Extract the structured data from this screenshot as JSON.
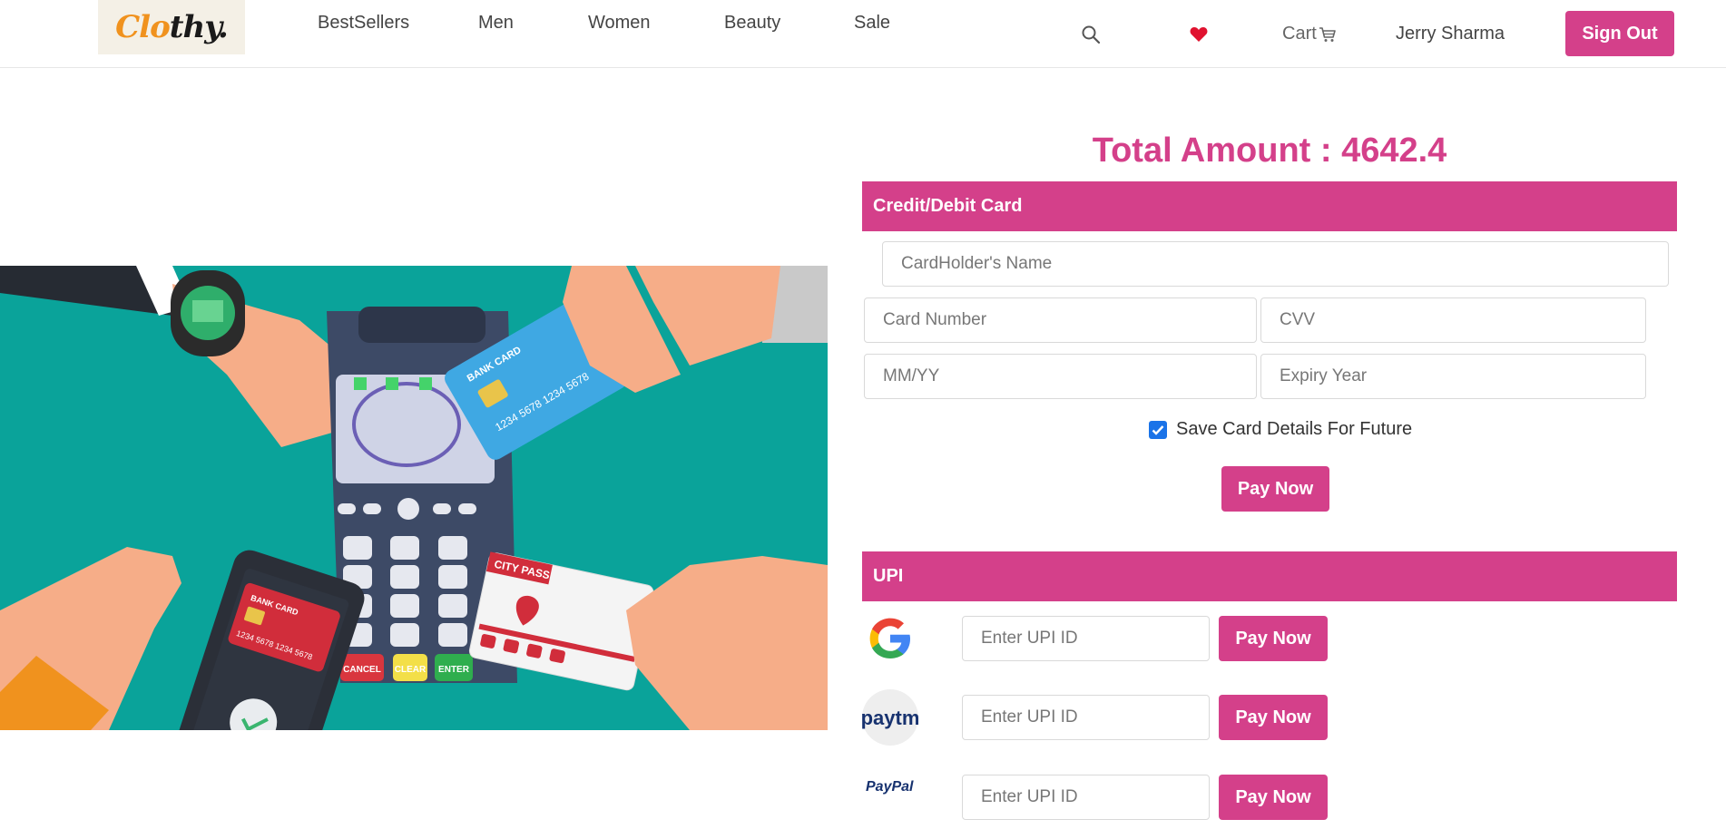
{
  "navbar": {
    "logo": {
      "orange": "Clo",
      "dark": "thy."
    },
    "links": [
      "BestSellers",
      "Men",
      "Women",
      "Beauty",
      "Sale"
    ],
    "search_icon": "search-icon",
    "wishlist_icon": "heart-icon",
    "cart_label": "Cart",
    "cart_icon": "cart-icon",
    "user_name": "Jerry Sharma",
    "signout_label": "Sign Out"
  },
  "payment": {
    "total_label": "Total Amount : 4642.4",
    "card_section": {
      "title": "Credit/Debit Card",
      "name_placeholder": "CardHolder's Name",
      "number_placeholder": "Card Number",
      "cvv_placeholder": "CVV",
      "month_placeholder": "MM/YY",
      "year_placeholder": "Expiry Year",
      "save_label": "Save Card Details For Future",
      "save_checked": true,
      "pay_label": "Pay Now"
    },
    "upi_section": {
      "title": "UPI",
      "providers": [
        {
          "name": "Google Pay",
          "placeholder": "Enter UPI ID",
          "pay_label": "Pay Now"
        },
        {
          "name": "Paytm",
          "logo_text": "paytm",
          "placeholder": "Enter UPI ID",
          "pay_label": "Pay Now"
        },
        {
          "name": "PayPal",
          "logo_text": "PayPal",
          "placeholder": "Enter UPI ID",
          "pay_label": "Pay Now"
        }
      ]
    }
  },
  "illustration": {
    "bank_card_label": "BANK CARD",
    "card_number": "1234 5678 1234 5678",
    "city_pass_label": "CITY PASS",
    "terminal_buttons": [
      "CANCEL",
      "CLEAR",
      "ENTER"
    ]
  },
  "colors": {
    "brand": "#d4408a",
    "logo_orange": "#f0921e",
    "teal": "#0aa39a"
  }
}
